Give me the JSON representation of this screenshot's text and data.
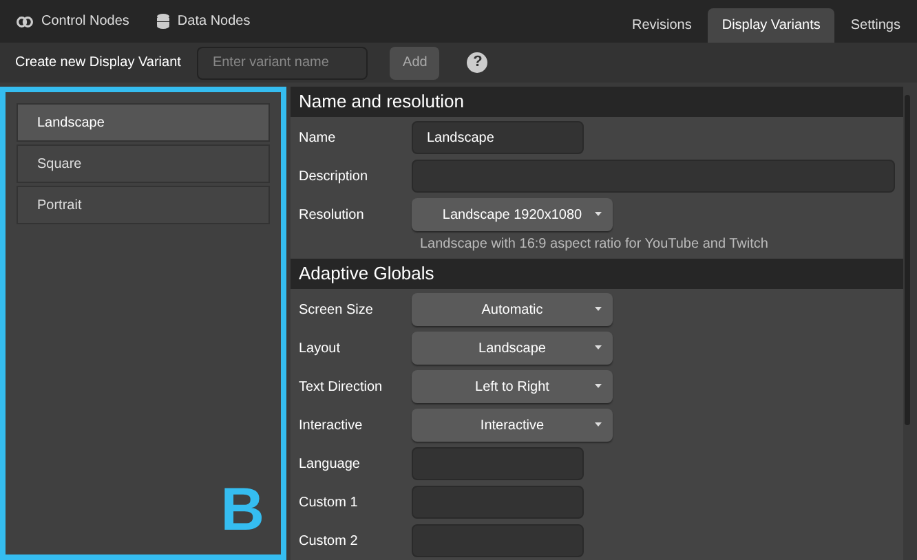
{
  "top_tabs_left": [
    {
      "label": "Control Nodes"
    },
    {
      "label": "Data Nodes"
    }
  ],
  "top_tabs_right": [
    {
      "label": "Revisions",
      "selected": false
    },
    {
      "label": "Display Variants",
      "selected": true
    },
    {
      "label": "Settings",
      "selected": false
    }
  ],
  "toolbar": {
    "label": "Create new Display Variant",
    "placeholder": "Enter variant name",
    "button": "Add",
    "help": "?"
  },
  "variants": [
    {
      "label": "Landscape",
      "selected": true
    },
    {
      "label": "Square",
      "selected": false
    },
    {
      "label": "Portrait",
      "selected": false
    }
  ],
  "annotation": "B",
  "sections": [
    {
      "title": "Name and resolution",
      "rows": [
        {
          "kind": "input",
          "label": "Name",
          "value": "Landscape"
        },
        {
          "kind": "wide_input",
          "label": "Description"
        },
        {
          "kind": "select",
          "label": "Resolution",
          "value": "Landscape 1920x1080",
          "hint": "Landscape with 16:9 aspect ratio for YouTube and Twitch"
        }
      ]
    },
    {
      "title": "Adaptive Globals",
      "rows": [
        {
          "kind": "select",
          "label": "Screen Size",
          "value": "Automatic"
        },
        {
          "kind": "select",
          "label": "Layout",
          "value": "Landscape"
        },
        {
          "kind": "select",
          "label": "Text Direction",
          "value": "Left to Right"
        },
        {
          "kind": "select",
          "label": "Interactive",
          "value": "Interactive"
        },
        {
          "kind": "input",
          "label": "Language"
        },
        {
          "kind": "input",
          "label": "Custom 1"
        },
        {
          "kind": "input",
          "label": "Custom 2"
        }
      ]
    }
  ]
}
